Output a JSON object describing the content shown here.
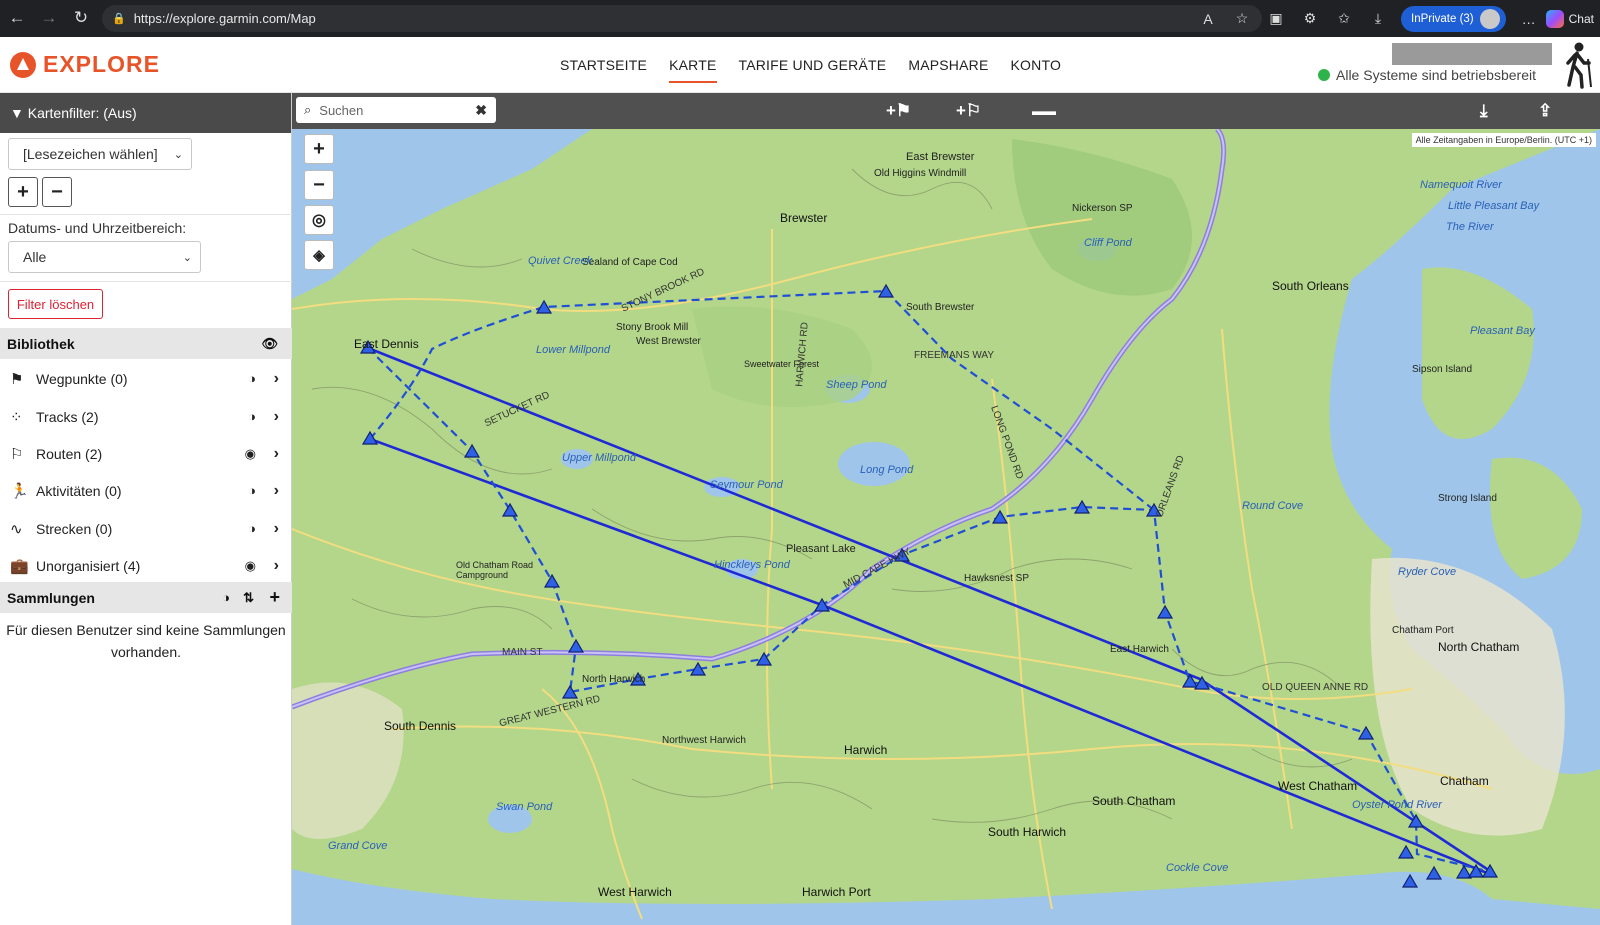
{
  "browser": {
    "url": "https://explore.garmin.com/Map",
    "inprivate_label": "InPrivate (3)",
    "chat_label": "Chat"
  },
  "header": {
    "logo_text": "EXPLORE",
    "nav": [
      "STARTSEITE",
      "KARTE",
      "TARIFE UND GERÄTE",
      "MAPSHARE",
      "KONTO"
    ],
    "active_nav": "KARTE",
    "status_text": "Alle Systeme sind betriebsbereit"
  },
  "sidebar": {
    "filter_title": "▼ Kartenfilter: (Aus)",
    "bookmark_select": "[Lesezeichen wählen]",
    "date_label": "Datums- und Uhrzeitbereich:",
    "date_select": "Alle",
    "clear_button": "Filter löschen",
    "library_title": "Bibliothek",
    "library_items": [
      {
        "label": "Wegpunkte (0)",
        "icon": "flag-icon",
        "visible": false
      },
      {
        "label": "Tracks (2)",
        "icon": "footprints-icon",
        "visible": false
      },
      {
        "label": "Routen (2)",
        "icon": "route-icon",
        "visible": true
      },
      {
        "label": "Aktivitäten (0)",
        "icon": "activity-icon",
        "visible": false
      },
      {
        "label": "Strecken (0)",
        "icon": "course-icon",
        "visible": false
      },
      {
        "label": "Unorganisiert (4)",
        "icon": "briefcase-icon",
        "visible": true
      }
    ],
    "collections_title": "Sammlungen",
    "collections_empty": "Für diesen Benutzer sind keine Sammlungen vorhanden."
  },
  "map_toolbar": {
    "search_placeholder": "Suchen"
  },
  "map": {
    "timezone_note": "Alle Zeitangaben in Europe/Berlin. (UTC +1)",
    "labels": {
      "east_brewster": "East Brewster",
      "old_higgins": "Old Higgins Windmill",
      "brewster": "Brewster",
      "nickerson": "Nickerson SP",
      "cliff_pond": "Cliff Pond",
      "south_brewster": "South Brewster",
      "freemans_way": "FREEMANS WAY",
      "south_orleans": "South Orleans",
      "east_dennis": "East Dennis",
      "sealand": "Sealand of Cape Cod",
      "stony_brook_mill": "Stony Brook Mill",
      "west_brewster": "West Brewster",
      "lower_millpond": "Lower Millpond",
      "sweetwater": "Sweetwater Forest",
      "sheep_pond": "Sheep Pond",
      "upper_millpond": "Upper Millpond",
      "long_pond": "Long Pond",
      "seymour_pond": "Seymour Pond",
      "pleasant_lake": "Pleasant Lake",
      "hawksnest": "Hawksnest SP",
      "round_cove": "Round Cove",
      "hinckleys_pond": "Hinckleys Pond",
      "old_chatham_road": "Old Chatham Road Campground",
      "east_harwich": "East Harwich",
      "north_harwich": "North Harwich",
      "south_dennis": "South Dennis",
      "northwest_harwich": "Northwest Harwich",
      "harwich": "Harwich",
      "west_chatham": "West Chatham",
      "south_chatham": "South Chatham",
      "south_harwich": "South Harwich",
      "chatham": "Chatham",
      "north_chatham": "North Chatham",
      "chatham_port": "Chatham Port",
      "ryder_cove": "Ryder Cove",
      "swan_pond": "Swan Pond",
      "grand_cove": "Grand Cove",
      "west_harwich": "West Harwich",
      "harwich_port": "Harwich Port",
      "oyster_pond_river": "Oyster Pond River",
      "cockle_cove": "Cockle Cove",
      "pleasant_bay": "Pleasant Bay",
      "little_pleasant_bay": "Little Pleasant Bay",
      "the_river": "The River",
      "namequoit_river": "Namequoit River",
      "sipson_island": "Sipson Island",
      "strong_island": "Strong Island",
      "main_st": "MAIN ST",
      "mid_cape_hwy": "MID CAPE HWY",
      "great_western_rd": "GREAT WESTERN RD",
      "harwich_rd": "HARWICH RD",
      "orleans_rd": "ORLEANS RD",
      "stony_brook_rd": "STONY BROOK RD",
      "setucket_rd": "SETUCKET RD",
      "queen_anne_rd": "OLD QUEEN ANNE RD",
      "long_pond_rd": "LONG POND RD",
      "quivet_creek": "Quivet Creek"
    }
  }
}
